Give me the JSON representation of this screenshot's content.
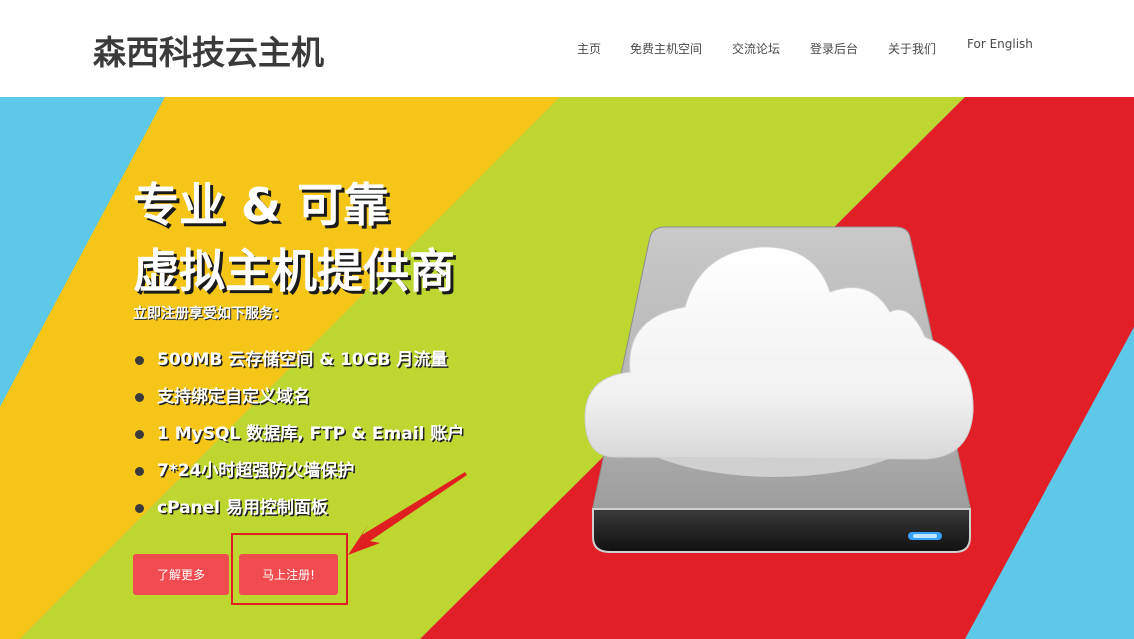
{
  "header": {
    "logo": "森西科技云主机",
    "nav": [
      {
        "label": "主页"
      },
      {
        "label": "免费主机空间"
      },
      {
        "label": "交流论坛"
      },
      {
        "label": "登录后台"
      },
      {
        "label": "关于我们"
      },
      {
        "label": "For English"
      }
    ]
  },
  "hero": {
    "headline_line1": "专业 & 可靠",
    "headline_line2": "虚拟主机提供商",
    "subtitle": "立即注册享受如下服务：",
    "features": [
      "500MB 云存储空间 & 10GB 月流量",
      "支持绑定自定义域名",
      "1 MySQL 数据库, FTP & Email 账户",
      "7*24小时超强防火墙保护",
      "cPanel 易用控制面板"
    ],
    "buttons": {
      "learn_more": "了解更多",
      "register": "马上注册!"
    }
  },
  "colors": {
    "stripe_blue": "#5ec8e8",
    "stripe_yellow": "#f5c518",
    "stripe_green": "#bdd630",
    "stripe_red": "#e21f26",
    "button": "#f04b4f",
    "annotation_red": "#e02020"
  },
  "icons": {
    "hero_image": "cloud-drive-icon",
    "annotation": "red-arrow-annotation"
  }
}
